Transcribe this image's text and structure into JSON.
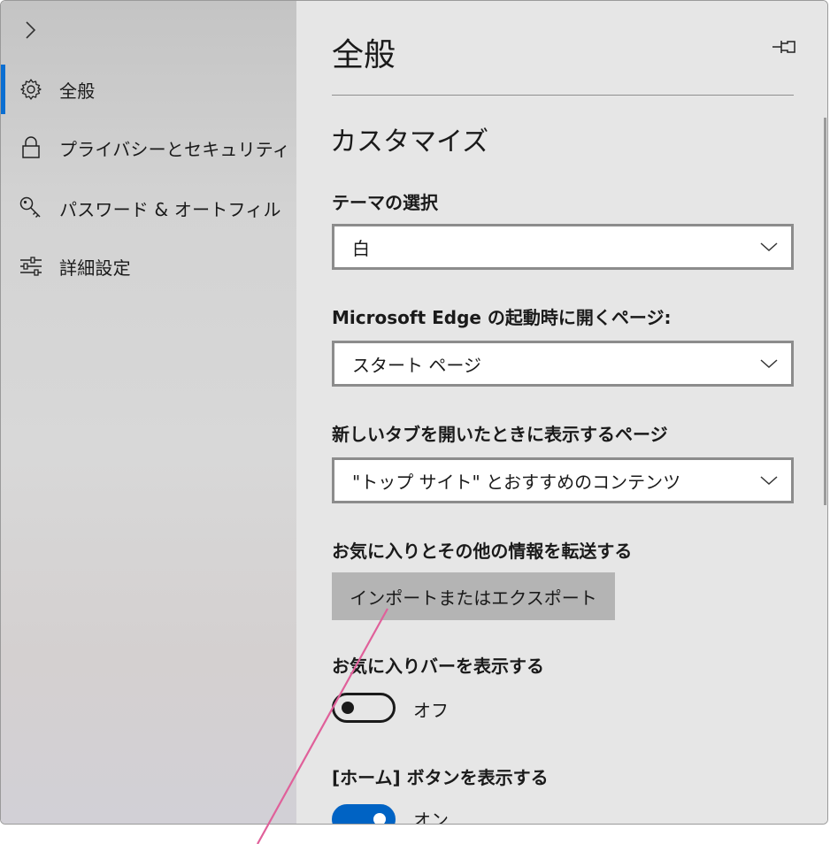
{
  "sidebar": {
    "items": [
      {
        "label": "全般",
        "icon": "gear-icon",
        "active": true
      },
      {
        "label": "プライバシーとセキュリティ",
        "icon": "lock-icon",
        "active": false
      },
      {
        "label": "パスワード & オートフィル",
        "icon": "key-icon",
        "active": false
      },
      {
        "label": "詳細設定",
        "icon": "sliders-icon",
        "active": false
      }
    ]
  },
  "header": {
    "title": "全般"
  },
  "main": {
    "section_title": "カスタマイズ",
    "theme": {
      "label": "テーマの選択",
      "value": "白"
    },
    "startup": {
      "label": "Microsoft Edge の起動時に開くページ:",
      "value": "スタート ページ"
    },
    "new_tab": {
      "label": "新しいタブを開いたときに表示するページ",
      "value": "\"トップ サイト\" とおすすめのコンテンツ"
    },
    "transfer": {
      "label": "お気に入りとその他の情報を転送する",
      "button_label": "インポートまたはエクスポート"
    },
    "favorites_bar": {
      "label": "お気に入りバーを表示する",
      "state_label": "オフ",
      "on": false
    },
    "home_button": {
      "label": "[ホーム] ボタンを表示する",
      "state_label": "オン",
      "on": true
    }
  },
  "colors": {
    "accent": "#0b6fd2",
    "toggle_on": "#0063c4",
    "callout_line": "#e0609a",
    "button_bg": "#b4b4b4",
    "content_bg": "#e6e6e6"
  }
}
